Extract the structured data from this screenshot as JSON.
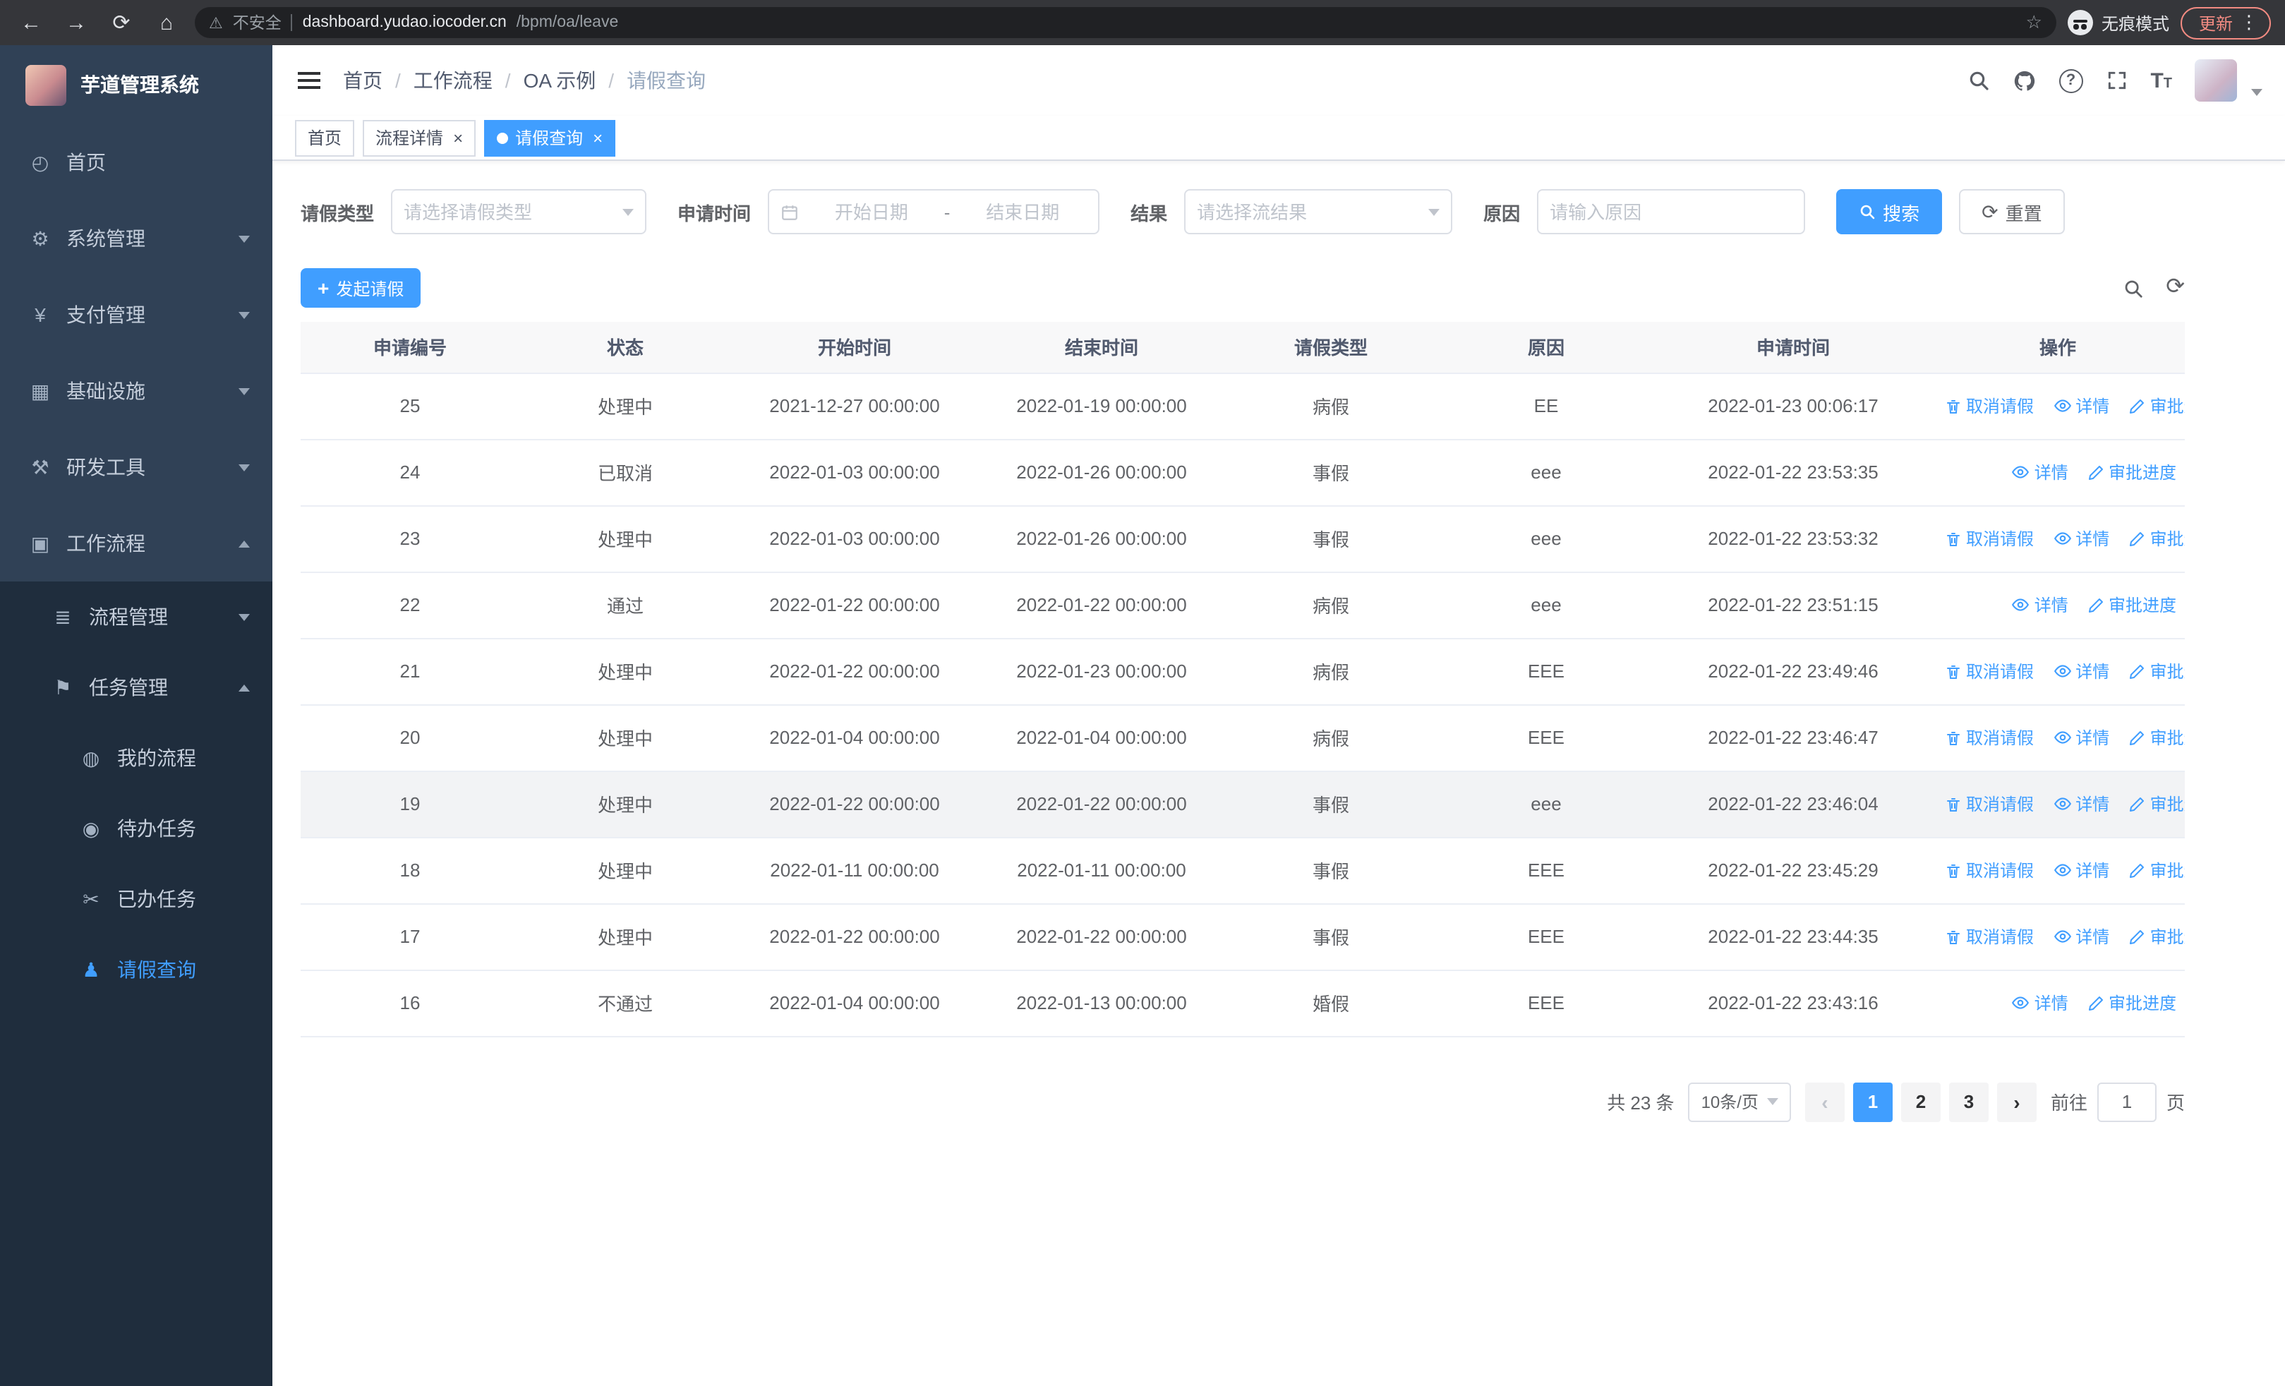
{
  "theme": {
    "primary_color": "#409EFF",
    "sidebar_bg": "#304156",
    "sidebar_sub_bg": "#1f2d3d"
  },
  "browser": {
    "security_label": "不安全",
    "url_host": "dashboard.yudao.iocoder.cn",
    "url_path": "/bpm/oa/leave",
    "incognito_label": "无痕模式",
    "update_label": "更新"
  },
  "sidebar": {
    "logo_title": "芋道管理系统",
    "items": [
      {
        "key": "home",
        "label": "首页",
        "icon": "dashboard-icon",
        "level": 1,
        "arrow": null,
        "active": false
      },
      {
        "key": "system",
        "label": "系统管理",
        "icon": "gear-icon",
        "level": 1,
        "arrow": "down",
        "active": false
      },
      {
        "key": "payment",
        "label": "支付管理",
        "icon": "yen-icon",
        "level": 1,
        "arrow": "down",
        "active": false
      },
      {
        "key": "infra",
        "label": "基础设施",
        "icon": "infra-icon",
        "level": 1,
        "arrow": "down",
        "active": false
      },
      {
        "key": "devtools",
        "label": "研发工具",
        "icon": "tools-icon",
        "level": 1,
        "arrow": "down",
        "active": false
      },
      {
        "key": "workflow",
        "label": "工作流程",
        "icon": "workflow-icon",
        "level": 1,
        "arrow": "up",
        "active": false
      },
      {
        "key": "process-mgmt",
        "label": "流程管理",
        "icon": "process-icon",
        "level": 2,
        "arrow": "down",
        "active": false
      },
      {
        "key": "task-mgmt",
        "label": "任务管理",
        "icon": "task-icon",
        "level": 2,
        "arrow": "up",
        "active": false
      },
      {
        "key": "my-process",
        "label": "我的流程",
        "icon": "chat-icon",
        "level": 3,
        "arrow": null,
        "active": false
      },
      {
        "key": "todo-task",
        "label": "待办任务",
        "icon": "eye-icon",
        "level": 3,
        "arrow": null,
        "active": false
      },
      {
        "key": "done-task",
        "label": "已办任务",
        "icon": "scissors-icon",
        "level": 3,
        "arrow": null,
        "active": false
      },
      {
        "key": "leave-query",
        "label": "请假查询",
        "icon": "user-icon",
        "level": 3,
        "arrow": null,
        "active": true
      }
    ]
  },
  "header": {
    "breadcrumb": [
      "首页",
      "工作流程",
      "OA 示例",
      "请假查询"
    ],
    "breadcrumb_separator": "/"
  },
  "tags": [
    {
      "key": "home",
      "label": "首页",
      "closable": false,
      "active": false
    },
    {
      "key": "process-detail",
      "label": "流程详情",
      "closable": true,
      "active": false
    },
    {
      "key": "leave-query",
      "label": "请假查询",
      "closable": true,
      "active": true
    }
  ],
  "filters": {
    "leave_type_label": "请假类型",
    "leave_type_placeholder": "请选择请假类型",
    "apply_time_label": "申请时间",
    "start_date_placeholder": "开始日期",
    "range_separator": "-",
    "end_date_placeholder": "结束日期",
    "result_label": "结果",
    "result_placeholder": "请选择流结果",
    "reason_label": "原因",
    "reason_placeholder": "请输入原因",
    "search_label": "搜索",
    "reset_label": "重置"
  },
  "toolbar": {
    "create_label": "发起请假"
  },
  "table": {
    "columns": [
      "申请编号",
      "状态",
      "开始时间",
      "结束时间",
      "请假类型",
      "原因",
      "申请时间",
      "操作"
    ],
    "actions": {
      "cancel": "取消请假",
      "detail": "详情",
      "progress": "审批进度"
    },
    "rows": [
      {
        "id": "25",
        "status": "处理中",
        "start": "2021-12-27 00:00:00",
        "end": "2022-01-19 00:00:00",
        "type": "病假",
        "reason": "EE",
        "apply_time": "2022-01-23 00:06:17",
        "can_cancel": true,
        "highlighted": false
      },
      {
        "id": "24",
        "status": "已取消",
        "start": "2022-01-03 00:00:00",
        "end": "2022-01-26 00:00:00",
        "type": "事假",
        "reason": "eee",
        "apply_time": "2022-01-22 23:53:35",
        "can_cancel": false,
        "highlighted": false
      },
      {
        "id": "23",
        "status": "处理中",
        "start": "2022-01-03 00:00:00",
        "end": "2022-01-26 00:00:00",
        "type": "事假",
        "reason": "eee",
        "apply_time": "2022-01-22 23:53:32",
        "can_cancel": true,
        "highlighted": false
      },
      {
        "id": "22",
        "status": "通过",
        "start": "2022-01-22 00:00:00",
        "end": "2022-01-22 00:00:00",
        "type": "病假",
        "reason": "eee",
        "apply_time": "2022-01-22 23:51:15",
        "can_cancel": false,
        "highlighted": false
      },
      {
        "id": "21",
        "status": "处理中",
        "start": "2022-01-22 00:00:00",
        "end": "2022-01-23 00:00:00",
        "type": "病假",
        "reason": "EEE",
        "apply_time": "2022-01-22 23:49:46",
        "can_cancel": true,
        "highlighted": false
      },
      {
        "id": "20",
        "status": "处理中",
        "start": "2022-01-04 00:00:00",
        "end": "2022-01-04 00:00:00",
        "type": "病假",
        "reason": "EEE",
        "apply_time": "2022-01-22 23:46:47",
        "can_cancel": true,
        "highlighted": false
      },
      {
        "id": "19",
        "status": "处理中",
        "start": "2022-01-22 00:00:00",
        "end": "2022-01-22 00:00:00",
        "type": "事假",
        "reason": "eee",
        "apply_time": "2022-01-22 23:46:04",
        "can_cancel": true,
        "highlighted": true
      },
      {
        "id": "18",
        "status": "处理中",
        "start": "2022-01-11 00:00:00",
        "end": "2022-01-11 00:00:00",
        "type": "事假",
        "reason": "EEE",
        "apply_time": "2022-01-22 23:45:29",
        "can_cancel": true,
        "highlighted": false
      },
      {
        "id": "17",
        "status": "处理中",
        "start": "2022-01-22 00:00:00",
        "end": "2022-01-22 00:00:00",
        "type": "事假",
        "reason": "EEE",
        "apply_time": "2022-01-22 23:44:35",
        "can_cancel": true,
        "highlighted": false
      },
      {
        "id": "16",
        "status": "不通过",
        "start": "2022-01-04 00:00:00",
        "end": "2022-01-13 00:00:00",
        "type": "婚假",
        "reason": "EEE",
        "apply_time": "2022-01-22 23:43:16",
        "can_cancel": false,
        "highlighted": false
      }
    ]
  },
  "pagination": {
    "total_text": "共 23 条",
    "page_size_text": "10条/页",
    "pages": [
      "1",
      "2",
      "3"
    ],
    "active_page": "1",
    "goto_label": "前往",
    "goto_value": "1",
    "goto_suffix": "页"
  }
}
